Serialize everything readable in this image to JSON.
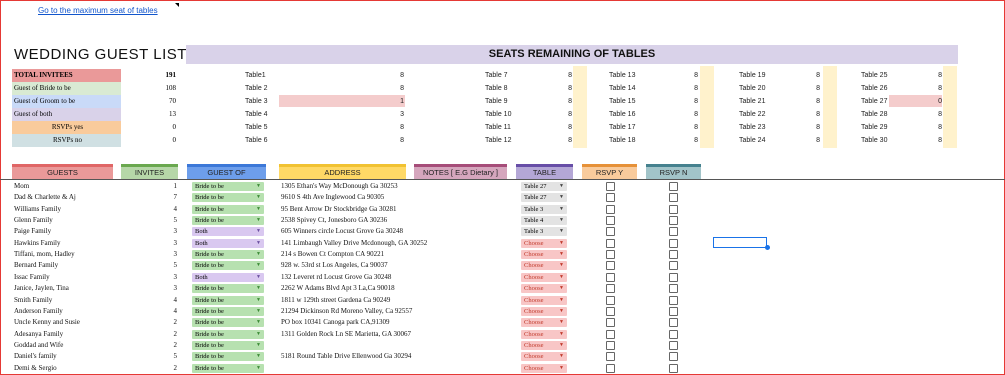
{
  "link_text": "Go to the maximum seat of tables",
  "title": "WEDDING GUEST LIST",
  "seats_title": "SEATS REMAINING OF TABLES",
  "summary": [
    {
      "label": "TOTAL INVITEES",
      "value": "191",
      "color": "#ea9999",
      "bold": true
    },
    {
      "label": "Guest of Bride to be",
      "value": "108",
      "color": "#d9ead3",
      "bold": false
    },
    {
      "label": "Guest of Groom to be",
      "value": "70",
      "color": "#c9daf8",
      "bold": false
    },
    {
      "label": "Guest of both",
      "value": "13",
      "color": "#d9d2e9",
      "bold": false
    },
    {
      "label": "RSVPs yes",
      "value": "0",
      "color": "#f9cb9c",
      "bold": false,
      "center": true
    },
    {
      "label": "RSVPs no",
      "value": "0",
      "color": "#d0e0e3",
      "bold": false,
      "center": true
    }
  ],
  "tables": [
    [
      {
        "name": "Table1",
        "seats": "8"
      },
      {
        "name": "Table 2",
        "seats": "8"
      },
      {
        "name": "Table 3",
        "seats": "1",
        "highlight": true
      },
      {
        "name": "Table 4",
        "seats": "3"
      },
      {
        "name": "Table 5",
        "seats": "8"
      },
      {
        "name": "Table 6",
        "seats": "8"
      }
    ],
    [
      {
        "name": "Table 7",
        "seats": "8"
      },
      {
        "name": "Table 8",
        "seats": "8"
      },
      {
        "name": "Table 9",
        "seats": "8"
      },
      {
        "name": "Table 10",
        "seats": "8"
      },
      {
        "name": "Table 11",
        "seats": "8"
      },
      {
        "name": "Table 12",
        "seats": "8"
      }
    ],
    [
      {
        "name": "Table 13",
        "seats": "8"
      },
      {
        "name": "Table 14",
        "seats": "8"
      },
      {
        "name": "Table 15",
        "seats": "8"
      },
      {
        "name": "Table 16",
        "seats": "8"
      },
      {
        "name": "Table 17",
        "seats": "8"
      },
      {
        "name": "Table 18",
        "seats": "8"
      }
    ],
    [
      {
        "name": "Table 19",
        "seats": "8"
      },
      {
        "name": "Table 20",
        "seats": "8"
      },
      {
        "name": "Table 21",
        "seats": "8"
      },
      {
        "name": "Table 22",
        "seats": "8"
      },
      {
        "name": "Table 23",
        "seats": "8"
      },
      {
        "name": "Table 24",
        "seats": "8"
      }
    ],
    [
      {
        "name": "Table 25",
        "seats": "8"
      },
      {
        "name": "Table 26",
        "seats": "8"
      },
      {
        "name": "Table 27",
        "seats": "0",
        "highlight": true
      },
      {
        "name": "Table 28",
        "seats": "8"
      },
      {
        "name": "Table 29",
        "seats": "8"
      },
      {
        "name": "Table 30",
        "seats": "8"
      }
    ]
  ],
  "headers": [
    {
      "label": "GUESTS",
      "color": "#ea9999",
      "bar": "#e06666"
    },
    {
      "label": "INVITES",
      "color": "#b6d7a8",
      "bar": "#6aa84f"
    },
    {
      "label": "GUEST OF",
      "color": "#6d9eeb",
      "bar": "#3c78d8"
    },
    {
      "label": "ADDRESS",
      "color": "#ffd966",
      "bar": "#f1c232"
    },
    {
      "label": "NOTES [ E.G Dietary ]",
      "color": "#d5a6bd",
      "bar": "#a64d79"
    },
    {
      "label": "TABLE",
      "color": "#b4a7d6",
      "bar": "#674ea7"
    },
    {
      "label": "RSVP Y",
      "color": "#f9cb9c",
      "bar": "#e69138"
    },
    {
      "label": "RSVP N",
      "color": "#a2c4c9",
      "bar": "#45818e"
    }
  ],
  "guests": [
    {
      "name": "Mom",
      "invites": "1",
      "guest_of": "Bride to be",
      "address": "1305 Ethan's Way McDonough Ga 30253",
      "table": "Table 27"
    },
    {
      "name": "Dad & Charlette & Aj",
      "invites": "7",
      "guest_of": "Bride to be",
      "address": "9610 S 4th Ave Inglewood Ca 90305",
      "table": "Table 27"
    },
    {
      "name": "Williams Family",
      "invites": "4",
      "guest_of": "Bride to be",
      "address": "95 Bent Arrow Dr Stockbridge Ga 30281",
      "table": "Table 3"
    },
    {
      "name": "Glenn Family",
      "invites": "5",
      "guest_of": "Bride to be",
      "address": "2538 Spivey Ct, Jonesboro GA 30236",
      "table": "Table 4"
    },
    {
      "name": "Paige Family",
      "invites": "3",
      "guest_of": "Both",
      "address": "605 Winners circle Locust Grove Ga 30248",
      "table": "Table 3"
    },
    {
      "name": "Hawkins Family",
      "invites": "3",
      "guest_of": "Both",
      "address": "141 Limbaugh Valley Drive Mcdonough, GA 30252",
      "table": "Choose"
    },
    {
      "name": "Tiffani, mom, Hadley",
      "invites": "3",
      "guest_of": "Bride to be",
      "address": "214 s Bowen Ct  Compton  CA 90221",
      "table": "Choose"
    },
    {
      "name": "Bernard Family",
      "invites": "5",
      "guest_of": "Bride to be",
      "address": "928 w. 53rd st Los Angeles, Ca 90037",
      "table": "Choose"
    },
    {
      "name": "Issac Family",
      "invites": "3",
      "guest_of": "Both",
      "address": "132 Leveret rd Locust Grove Ga 30248",
      "table": "Choose"
    },
    {
      "name": "Janice, Jaylen, Tina",
      "invites": "3",
      "guest_of": "Bride to be",
      "address": "2262 W Adams Blvd Apt 3 La,Ca 90018",
      "table": "Choose"
    },
    {
      "name": "Smith Family",
      "invites": "4",
      "guest_of": "Bride to be",
      "address": "1811 w 129th street Gardena Ca  90249",
      "table": "Choose"
    },
    {
      "name": "Anderson Family",
      "invites": "4",
      "guest_of": "Bride to be",
      "address": "21294 Dickinson Rd Moreno Valley, Ca 92557",
      "table": "Choose"
    },
    {
      "name": "Uncle Kenny and Susie",
      "invites": "2",
      "guest_of": "Bride to be",
      "address": " PO box 10341 Canoga park CA,91309",
      "table": "Choose"
    },
    {
      "name": "Adesanya Family",
      "invites": "2",
      "guest_of": "Bride to be",
      "address": "1311 Golden Rock Ln SE Marietta, GA 30067",
      "table": "Choose"
    },
    {
      "name": "Goddad and Wife",
      "invites": "2",
      "guest_of": "Bride to be",
      "address": "",
      "table": "Choose"
    },
    {
      "name": "Daniel's family",
      "invites": "5",
      "guest_of": "Bride to be",
      "address": "5181 Round Table Drive Ellenwood Ga 30294",
      "table": "Choose"
    },
    {
      "name": "Demi & Sergio",
      "invites": "2",
      "guest_of": "Bride to be",
      "address": "",
      "table": "Choose"
    }
  ],
  "colors": {
    "bride": "#b7e1b0",
    "both": "#d9c8f0",
    "table_set": "#e3e3e3",
    "choose": "#f8c6c6",
    "highlight": "#f4cccc",
    "strip": "#fff2cc"
  }
}
